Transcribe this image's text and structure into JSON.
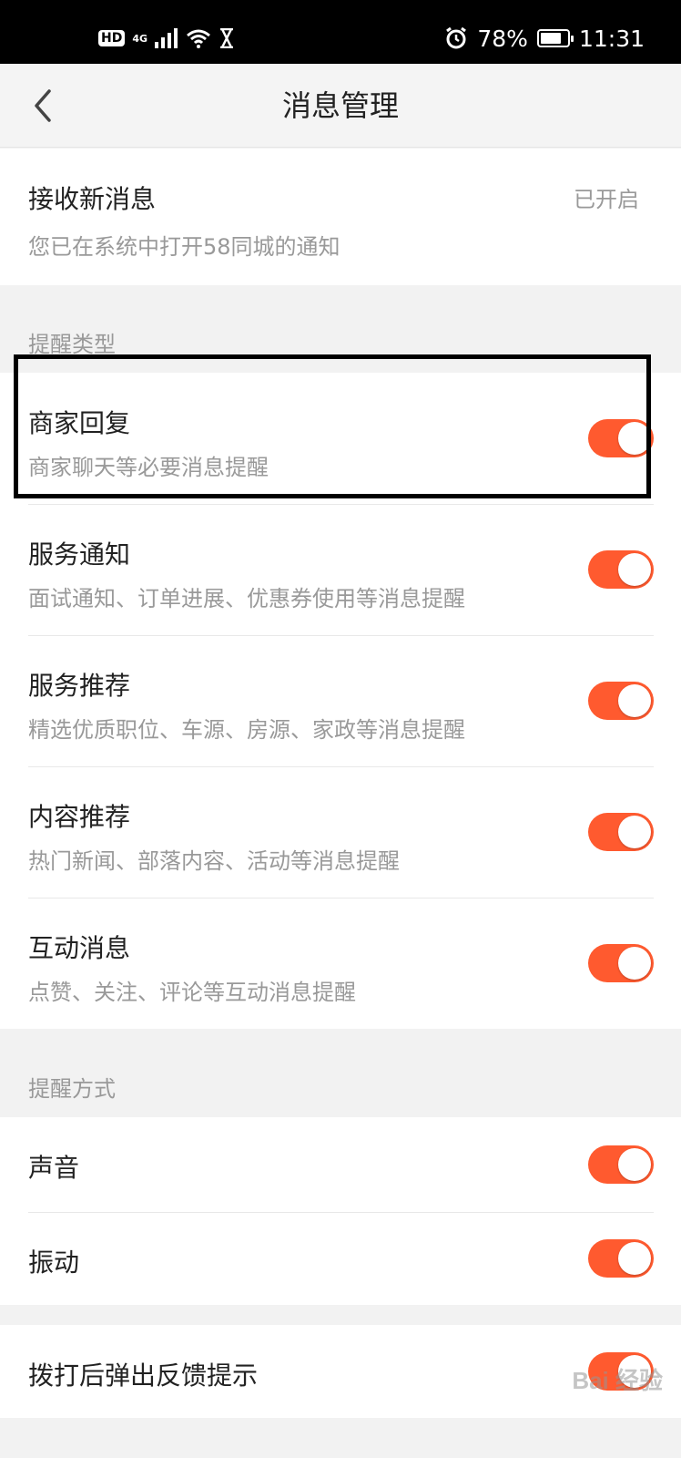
{
  "status_bar": {
    "left_badges": [
      "HD",
      "4G"
    ],
    "battery_percent": "78%",
    "battery_level": 0.78,
    "time": "11:31",
    "icons": [
      "hd-icon",
      "signal-icon",
      "wifi-icon",
      "hourglass-icon",
      "alarm-icon",
      "battery-icon"
    ]
  },
  "header": {
    "back_icon": "chevron-left-icon",
    "title": "消息管理"
  },
  "receive": {
    "title": "接收新消息",
    "subtitle": "您已在系统中打开58同城的通知",
    "status": "已开启"
  },
  "reminder_types": {
    "label": "提醒类型",
    "items": [
      {
        "title": "商家回复",
        "subtitle": "商家聊天等必要消息提醒",
        "enabled": true
      },
      {
        "title": "服务通知",
        "subtitle": "面试通知、订单进展、优惠券使用等消息提醒",
        "enabled": true
      },
      {
        "title": "服务推荐",
        "subtitle": "精选优质职位、车源、房源、家政等消息提醒",
        "enabled": true
      },
      {
        "title": "内容推荐",
        "subtitle": "热门新闻、部落内容、活动等消息提醒",
        "enabled": true
      },
      {
        "title": "互动消息",
        "subtitle": "点赞、关注、评论等互动消息提醒",
        "enabled": true
      }
    ]
  },
  "reminder_methods": {
    "label": "提醒方式",
    "items": [
      {
        "title": "声音",
        "enabled": true
      },
      {
        "title": "振动",
        "enabled": true
      }
    ]
  },
  "feedback": {
    "title": "拨打后弹出反馈提示",
    "enabled": true
  },
  "watermark": "Bai 经验",
  "colors": {
    "toggle_on": "#ff5a2f",
    "background": "#f2f2f2",
    "highlight_border": "#000000"
  }
}
